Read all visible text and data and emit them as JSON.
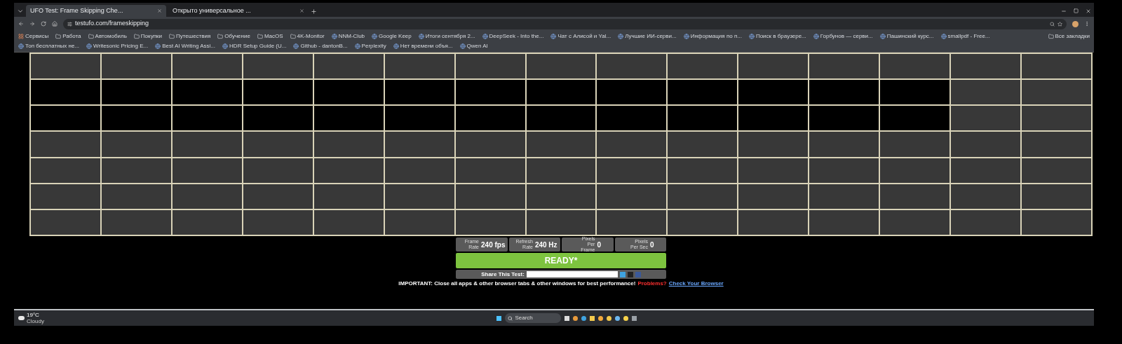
{
  "tabs": [
    {
      "title": "UFO Test: Frame Skipping Che...",
      "selected": true
    },
    {
      "title": "Открыто универсальное ...",
      "selected": false
    }
  ],
  "address_bar": {
    "url": "testufo.com/frameskipping"
  },
  "bookmarks": [
    {
      "label": "Сервисы",
      "kind": "apps"
    },
    {
      "label": "Работа",
      "kind": "folder"
    },
    {
      "label": "Автомобиль",
      "kind": "folder"
    },
    {
      "label": "Покупки",
      "kind": "folder"
    },
    {
      "label": "Путешествия",
      "kind": "folder"
    },
    {
      "label": "Обучение",
      "kind": "folder"
    },
    {
      "label": "MacOS",
      "kind": "folder"
    },
    {
      "label": "4K-Monitor",
      "kind": "folder"
    },
    {
      "label": "NNM-Club",
      "kind": "site"
    },
    {
      "label": "Google Keep",
      "kind": "site"
    },
    {
      "label": "Итоги сентября 2...",
      "kind": "site"
    },
    {
      "label": "DeepSeek - Into the...",
      "kind": "site"
    },
    {
      "label": "Чат с Алисой и Yal...",
      "kind": "site"
    },
    {
      "label": "Лучшие ИИ-серви...",
      "kind": "site"
    },
    {
      "label": "Информация по п...",
      "kind": "site"
    },
    {
      "label": "Поиск в браузере...",
      "kind": "site"
    },
    {
      "label": "Горбунов — серви...",
      "kind": "site"
    },
    {
      "label": "Пашинский курс...",
      "kind": "site"
    },
    {
      "label": "smallpdf - Free...",
      "kind": "site"
    },
    {
      "label": "Топ бесплатных не...",
      "kind": "site"
    },
    {
      "label": "Writesonic Pricing E...",
      "kind": "site"
    },
    {
      "label": "Best AI Writing Assi...",
      "kind": "site"
    },
    {
      "label": "HDR Setup Guide (U...",
      "kind": "site"
    },
    {
      "label": "Github - dantonB...",
      "kind": "site"
    },
    {
      "label": "Perplexity",
      "kind": "site"
    },
    {
      "label": "Нет времени объя...",
      "kind": "site"
    },
    {
      "label": "Qwen AI",
      "kind": "site"
    }
  ],
  "all_bookmarks": "Все закладки",
  "test_panel": {
    "stats": [
      {
        "label": "Frame Rate",
        "value": "240 fps"
      },
      {
        "label": "Refresh Rate",
        "value": "240 Hz"
      },
      {
        "label": "Pixels Per Frame",
        "value": "0"
      },
      {
        "label": "Pixels Per Sec",
        "value": "0"
      }
    ],
    "status": "READY*",
    "share_label": "Share This Test:",
    "notice": "IMPORTANT: Close all apps & other browser tabs & other windows for best performance!",
    "problems_link": "Problems?",
    "check_link": "Check Your Browser"
  },
  "taskbar": {
    "weather": {
      "temperature": "19°C",
      "condition": "Cloudy"
    },
    "search": {
      "placeholder": "Search"
    }
  }
}
